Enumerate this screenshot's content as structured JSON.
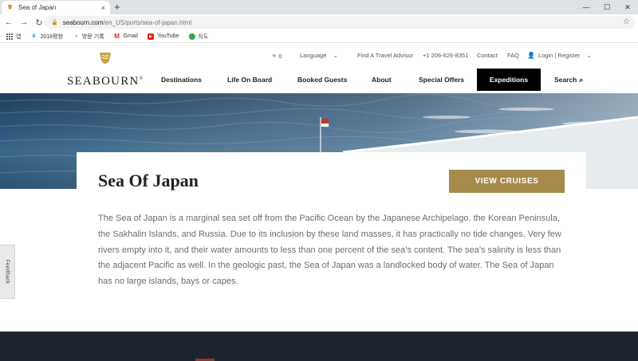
{
  "browser": {
    "tab_title": "Sea of Japan",
    "tab_close": "×",
    "new_tab": "+",
    "url_host": "seabourn.com",
    "url_path": "/en_US/ports/sea-of-japan.html",
    "bookmarks": [
      {
        "label": "앱",
        "icon": "apps-grid-icon"
      },
      {
        "label": "2018평창",
        "icon": "pyeongchang-icon"
      },
      {
        "label": "방문 기록",
        "icon": "history-icon"
      },
      {
        "label": "Gmail",
        "icon": "gmail-icon"
      },
      {
        "label": "YouTube",
        "icon": "youtube-icon"
      },
      {
        "label": "지도",
        "icon": "maps-icon"
      }
    ]
  },
  "header": {
    "brand": "SEABOURN",
    "brand_mark": "®",
    "favorites_count": "0",
    "language": "Language",
    "find_advisor": "Find A Travel Advisor",
    "phone": "+1 206-626-8351",
    "contact": "Contact",
    "faq": "FAQ",
    "login": "Login | Register",
    "nav": [
      {
        "label": "Destinations"
      },
      {
        "label": "Life On Board"
      },
      {
        "label": "Booked Guests"
      },
      {
        "label": "About"
      },
      {
        "label": "Special Offers"
      },
      {
        "label": "Expeditions",
        "active": true
      },
      {
        "label": "Search"
      }
    ]
  },
  "content": {
    "title": "Sea Of Japan",
    "cta": "VIEW CRUISES",
    "description": "The Sea of Japan is a marginal sea set off from the Pacific Ocean by the Japanese Archipelago, the Korean Peninsula, the Sakhalin Islands, and Russia. Due to its inclusion by these land masses, it has practically no tide changes. Very few rivers empty into it, and their water amounts to less than one percent of the sea’s content. The sea’s salinity is less than the adjacent Pacific as well. In the geologic past, the Sea of Japan was a landlocked body of water. The Sea of Japan has no large islands, bays or capes."
  },
  "feedback": "Feedback",
  "colors": {
    "gold": "#a58a4b",
    "nav_active_bg": "#000000",
    "footer": "#1c232c"
  }
}
